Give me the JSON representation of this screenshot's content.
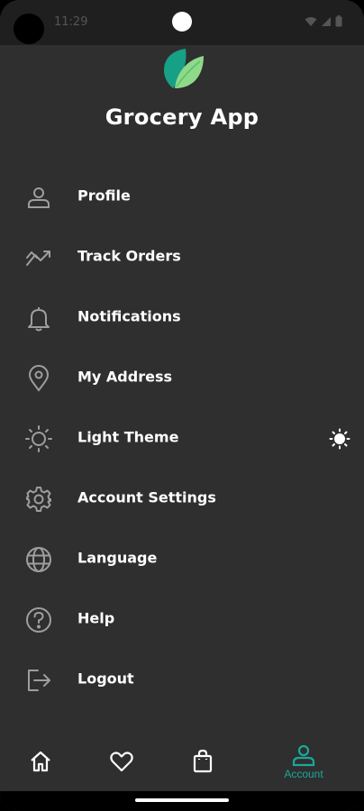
{
  "status_bar": {
    "time": "11:29"
  },
  "app": {
    "title": "Grocery App",
    "logo_icon": "leaf-icon",
    "accent_color": "#1aa89a"
  },
  "menu": {
    "items": [
      {
        "label": "Profile",
        "icon": "person-icon"
      },
      {
        "label": "Track Orders",
        "icon": "trend-icon"
      },
      {
        "label": "Notifications",
        "icon": "bell-icon"
      },
      {
        "label": "My Address",
        "icon": "location-pin-icon"
      },
      {
        "label": "Light Theme",
        "icon": "sun-outline-icon",
        "trailing_icon": "sun-icon"
      },
      {
        "label": "Account Settings",
        "icon": "gear-icon"
      },
      {
        "label": "Language",
        "icon": "globe-icon"
      },
      {
        "label": "Help",
        "icon": "question-icon"
      },
      {
        "label": "Logout",
        "icon": "logout-icon"
      }
    ]
  },
  "bottom_nav": {
    "items": [
      {
        "icon": "home-icon",
        "label": ""
      },
      {
        "icon": "heart-icon",
        "label": ""
      },
      {
        "icon": "shopping-bag-icon",
        "label": ""
      },
      {
        "icon": "account-icon",
        "label": "Account",
        "active": true
      }
    ]
  }
}
